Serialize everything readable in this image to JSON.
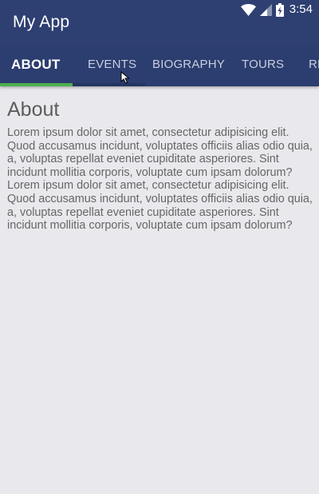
{
  "status_bar": {
    "time": "3:54",
    "icons": [
      "wifi-icon",
      "signal-icon",
      "battery-charging-icon"
    ]
  },
  "app_bar": {
    "title": "My App",
    "background": "#2e3f71"
  },
  "tabs": [
    {
      "label": "ABOUT",
      "selected": true
    },
    {
      "label": "EVENTS",
      "selected": false
    },
    {
      "label": "BIOGRAPHY",
      "selected": false
    },
    {
      "label": "TOURS",
      "selected": false
    },
    {
      "label": "RE",
      "selected": false
    }
  ],
  "tab_indicator_color": "#4caf50",
  "content": {
    "heading": "About",
    "body": "Lorem ipsum dolor sit amet, consectetur adipisicing elit. Quod accusamus incidunt, voluptates officiis alias odio quia, a, voluptas repellat eveniet cupiditate asperiores. Sint incidunt mollitia corporis, voluptate cum ipsam dolorum? Lorem ipsum dolor sit amet, consectetur adipisicing elit. Quod accusamus incidunt, voluptates officiis alias odio quia, a, voluptas repellat eveniet cupiditate asperiores. Sint incidunt mollitia corporis, voluptate cum ipsam dolorum?"
  }
}
